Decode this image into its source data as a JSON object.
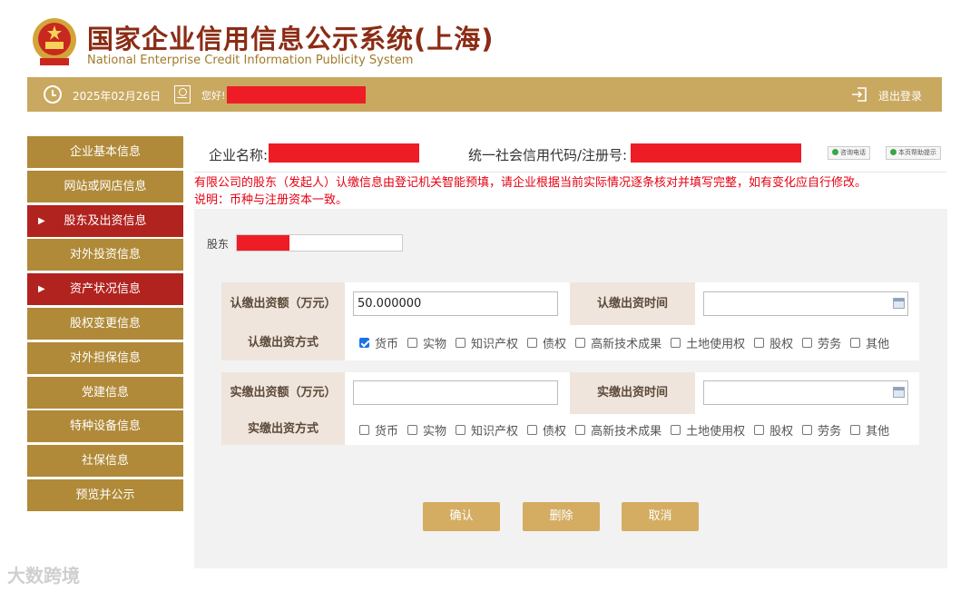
{
  "header": {
    "title_cn": "国家企业信用信息公示系统(上海)",
    "title_en": "National Enterprise Credit Information Publicity System"
  },
  "topbar": {
    "date": "2025年02月26日",
    "greeting": "您好!",
    "logout": "退出登录"
  },
  "sidebar": {
    "items": [
      {
        "label": "企业基本信息",
        "active": false
      },
      {
        "label": "网站或网店信息",
        "active": false
      },
      {
        "label": "股东及出资信息",
        "active": true
      },
      {
        "label": "对外投资信息",
        "active": false
      },
      {
        "label": "资产状况信息",
        "active": true
      },
      {
        "label": "股权变更信息",
        "active": false
      },
      {
        "label": "对外担保信息",
        "active": false
      },
      {
        "label": "党建信息",
        "active": false
      },
      {
        "label": "特种设备信息",
        "active": false
      },
      {
        "label": "社保信息",
        "active": false
      },
      {
        "label": "预览并公示",
        "active": false
      }
    ]
  },
  "main": {
    "company_label": "企业名称:",
    "code_label": "统一社会信用代码/注册号:",
    "btn_phone": "咨询电话",
    "btn_help": "本页帮助提示",
    "notice_line1": "有限公司的股东（发起人）认缴信息由登记机关智能预填，请企业根据当前实际情况逐条核对并填写完整，如有变化应自行修改。",
    "notice_line2": "说明：币种与注册资本一致。",
    "shareholder_label": "股东"
  },
  "form": {
    "subscribed_amount_label": "认缴出资额（万元）",
    "subscribed_amount_value": "50.000000",
    "subscribed_time_label": "认缴出资时间",
    "subscribed_method_label": "认缴出资方式",
    "paid_amount_label": "实缴出资额（万元）",
    "paid_amount_value": "",
    "paid_time_label": "实缴出资时间",
    "paid_method_label": "实缴出资方式",
    "methods": [
      "货币",
      "实物",
      "知识产权",
      "债权",
      "高新技术成果",
      "土地使用权",
      "股权",
      "劳务",
      "其他"
    ],
    "subscribed_checked": [
      true,
      false,
      false,
      false,
      false,
      false,
      false,
      false,
      false
    ],
    "paid_checked": [
      false,
      false,
      false,
      false,
      false,
      false,
      false,
      false,
      false
    ]
  },
  "buttons": {
    "confirm": "确认",
    "delete": "删除",
    "cancel": "取消"
  },
  "watermark": "大数跨境",
  "colors": {
    "gold": "#c9a860",
    "sidebar": "#b08a38",
    "active": "#b1231f",
    "notice_red": "#e60012",
    "redaction": "#ee1c25"
  }
}
